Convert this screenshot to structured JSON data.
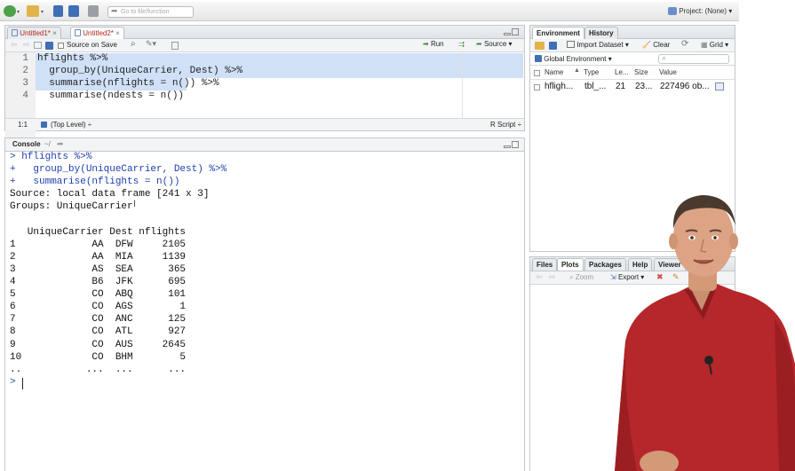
{
  "toolbar": {
    "goto_placeholder": "Go to file/function",
    "project_label": "Project: (None)"
  },
  "source": {
    "tabs": [
      "Untitled1*",
      "Untitled2*"
    ],
    "source_on_save": "Source on Save",
    "run_label": "Run",
    "source_label": "Source",
    "lines": [
      {
        "n": "1",
        "text": "hflights %>%"
      },
      {
        "n": "2",
        "text": "  group_by(UniqueCarrier, Dest) %>%"
      },
      {
        "n": "3",
        "text": "  summarise(nflights = n()) %>%"
      },
      {
        "n": "4",
        "text": "  summarise(ndests = n())"
      }
    ],
    "status_pos": "1:1",
    "status_scope": "(Top Level) ÷",
    "status_type": "R Script ÷"
  },
  "console": {
    "title": "Console",
    "path": "~/",
    "lines": [
      "> hflights %>%",
      "+   group_by(UniqueCarrier, Dest) %>%",
      "+   summarise(nflights = n())",
      "Source: local data frame [241 x 3]",
      "Groups: UniqueCarrier",
      "",
      "   UniqueCarrier Dest nflights",
      "1             AA  DFW     2105",
      "2             AA  MIA     1139",
      "3             AS  SEA      365",
      "4             B6  JFK      695",
      "5             CO  ABQ      101",
      "6             CO  AGS        1",
      "7             CO  ANC      125",
      "8             CO  ATL      927",
      "9             CO  AUS     2645",
      "10            CO  BHM        5",
      "..           ...  ...      ...",
      "> "
    ]
  },
  "environment": {
    "tabs": [
      "Environment",
      "History"
    ],
    "import_label": "Import Dataset ▾",
    "clear_label": "Clear",
    "grid_label": "Grid ▾",
    "scope_label": "Global Environment ▾",
    "columns": [
      "Name",
      "Type",
      "Le...",
      "Size",
      "Value"
    ],
    "row": {
      "name": "hfligh...",
      "type": "tbl_...",
      "length": "21",
      "size": "23...",
      "value": "227496 ob..."
    }
  },
  "files": {
    "tabs": [
      "Files",
      "Plots",
      "Packages",
      "Help",
      "Viewer"
    ],
    "zoom_label": "Zoom",
    "export_label": "Export ▾"
  },
  "colors": {
    "selection": "#cfe0f7",
    "console_input": "#1f3fb0",
    "pane_border": "#c3c7cc",
    "shirt": "#b5272a"
  }
}
